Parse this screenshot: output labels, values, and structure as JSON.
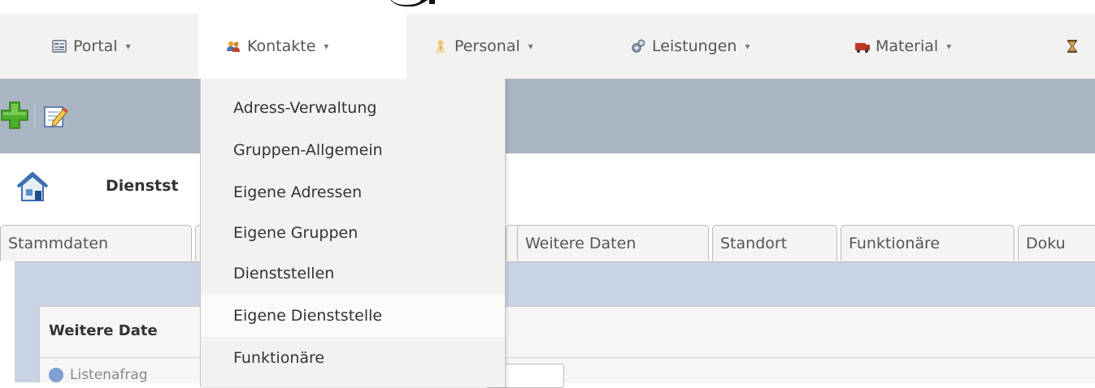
{
  "menubar": {
    "items": [
      {
        "label": "Portal",
        "icon": "portal-icon"
      },
      {
        "label": "Kontakte",
        "icon": "contacts-icon",
        "active": true
      },
      {
        "label": "Personal",
        "icon": "person-icon"
      },
      {
        "label": "Leistungen",
        "icon": "services-icon"
      },
      {
        "label": "Material",
        "icon": "material-icon"
      },
      {
        "label": "",
        "icon": "hourglass-icon"
      }
    ],
    "caret": "▾"
  },
  "toolbar": {
    "buttons": [
      {
        "icon": "add-icon"
      },
      {
        "icon": "edit-icon"
      }
    ]
  },
  "header": {
    "title": "Dienstst",
    "icon": "home-icon"
  },
  "tabs": [
    {
      "label": "Stammdaten"
    },
    {
      "label": ""
    },
    {
      "label": ""
    },
    {
      "label": "Weitere Daten"
    },
    {
      "label": "Standort"
    },
    {
      "label": "Funktionäre"
    },
    {
      "label": "Doku"
    }
  ],
  "panel": {
    "title": "Weitere Date",
    "paren": ")",
    "list_query_label": "Listenafrag"
  },
  "dropdown": {
    "items": [
      {
        "label": "Adress-Verwaltung"
      },
      {
        "label": "Gruppen-Allgemein"
      },
      {
        "label": "Eigene Adressen"
      },
      {
        "label": "Eigene Gruppen"
      },
      {
        "label": "Dienststellen"
      },
      {
        "label": "Eigene Dienststelle",
        "hover": true
      },
      {
        "label": "Funktionäre"
      }
    ]
  },
  "colors": {
    "menubar_bg": "#f2f2f2",
    "toolbar_bg": "#aab5c4",
    "tabpanel_bg": "#c8d4e3",
    "accent_green": "#4caf2a"
  }
}
